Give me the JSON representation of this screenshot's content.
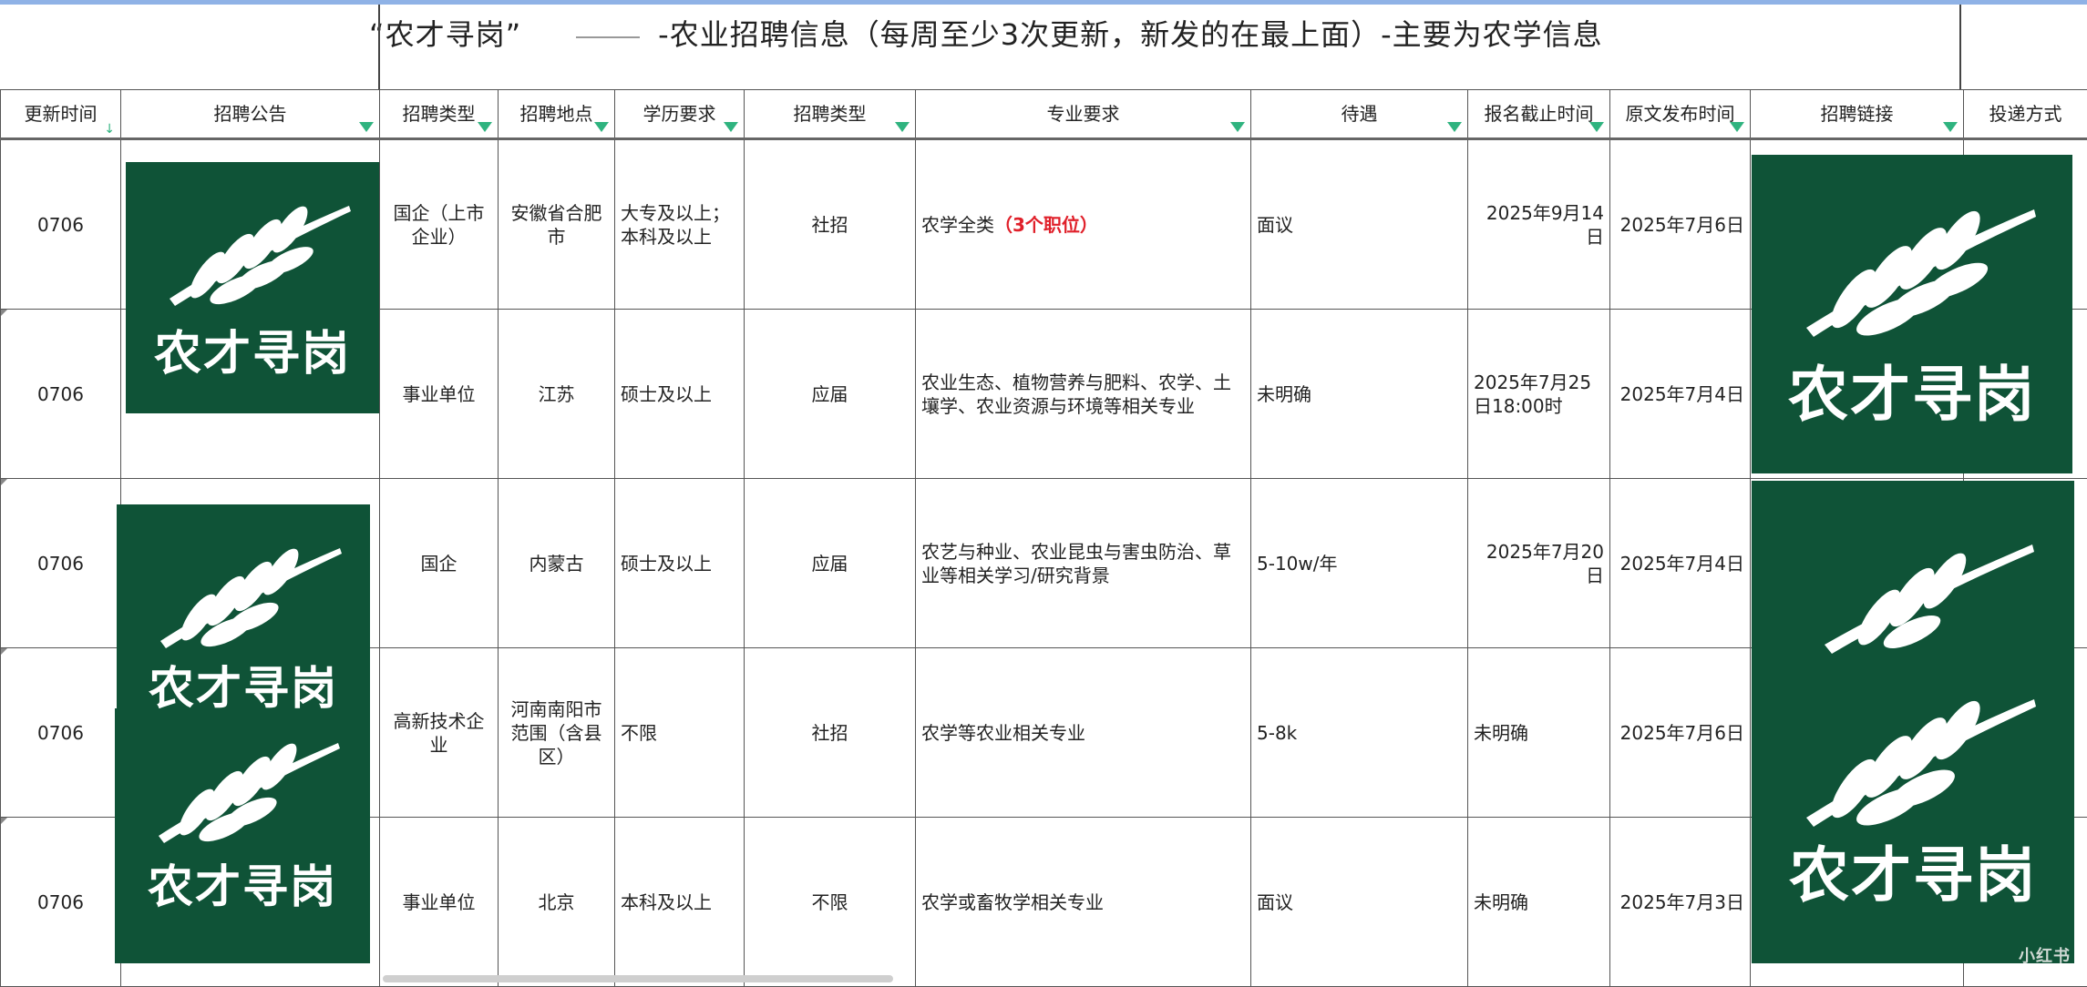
{
  "title": {
    "part1": "“农才寻岗”",
    "part2": "-农业招聘信息（每周至少3次更新，新发的在最上面）-主要为农学信息"
  },
  "headers": {
    "update_time": "更新时间",
    "notice": "招聘公告",
    "org_type": "招聘类型",
    "location": "招聘地点",
    "education": "学历要求",
    "hire_type": "招聘类型",
    "major": "专业要求",
    "salary": "待遇",
    "deadline": "报名截止时间",
    "published": "原文发布时间",
    "link": "招聘链接",
    "delivery": "投递方式"
  },
  "rows": [
    {
      "update_time": "0706",
      "org_type": "国企（上市企业）",
      "location": "安徽省合肥市",
      "education": "大专及以上；本科及以上",
      "hire_type": "社招",
      "major": "农学全类",
      "major_highlight": "（3个职位）",
      "salary": "面议",
      "deadline": "2025年9月14日",
      "published": "2025年7月6日"
    },
    {
      "update_time": "0706",
      "org_type": "事业单位",
      "location": "江苏",
      "education": "硕士及以上",
      "hire_type": "应届",
      "major": "农业生态、植物营养与肥料、农学、土壤学、农业资源与环境等相关专业",
      "major_highlight": "",
      "salary": "未明确",
      "deadline": "2025年7月25日18:00时",
      "published": "2025年7月4日"
    },
    {
      "update_time": "0706",
      "org_type": "国企",
      "location": "内蒙古",
      "education": "硕士及以上",
      "hire_type": "应届",
      "major": "农艺与种业、农业昆虫与害虫防治、草业等相关学习/研究背景",
      "major_highlight": "",
      "salary": "5-10w/年",
      "deadline": "2025年7月20日",
      "published": "2025年7月4日"
    },
    {
      "update_time": "0706",
      "org_type": "高新技术企业",
      "location": "河南南阳市范围（含县区）",
      "education": "不限",
      "hire_type": "社招",
      "major": "农学等农业相关专业",
      "major_highlight": "",
      "salary": "5-8k",
      "deadline": "未明确",
      "published": "2025年7月6日"
    },
    {
      "update_time": "0706",
      "org_type": "事业单位",
      "location": "北京",
      "education": "本科及以上",
      "hire_type": "不限",
      "major": "农学或畜牧学相关专业",
      "major_highlight": "",
      "salary": "面议",
      "deadline": "未明确",
      "published": "2025年7月3日"
    }
  ],
  "logo_text": "农才寻岗",
  "watermark_badge": "小红书",
  "colors": {
    "logo_bg": "#0f5337",
    "header_underline": "#39a56b",
    "filter_icon": "#2fb37f",
    "highlight": "#e0202a"
  }
}
